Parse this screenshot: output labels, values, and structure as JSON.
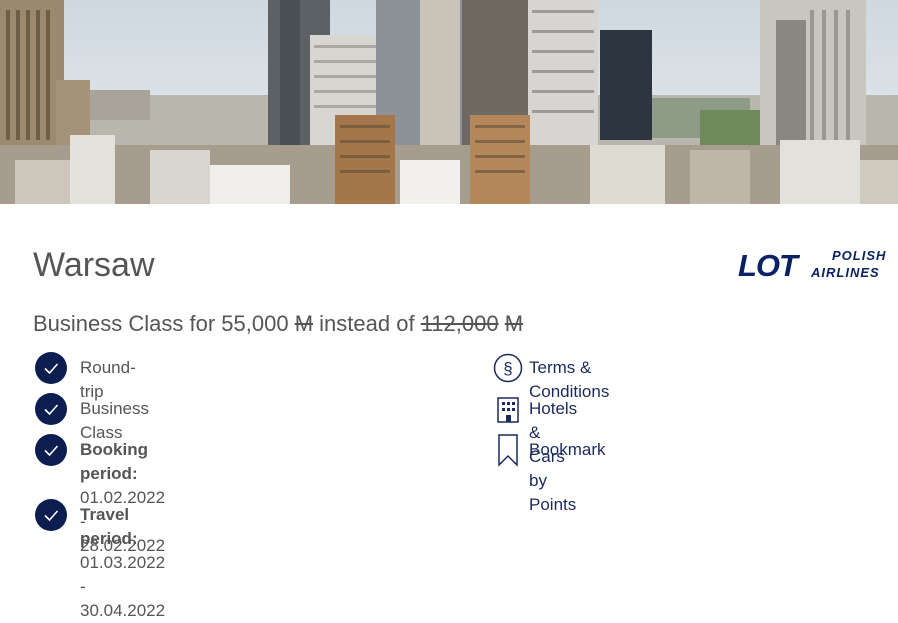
{
  "header": {
    "image_alt": "Warsaw skyline"
  },
  "destination": {
    "title": "Warsaw"
  },
  "brand": {
    "logo_main": "LOT",
    "logo_line1": "POLISH",
    "logo_line2": "AIRLINES"
  },
  "offer": {
    "prefix": "Business Class for 55,000",
    "currency": "M",
    "middle": "instead of",
    "old_price": "112,000",
    "old_currency": "M"
  },
  "features": [
    {
      "label": "Round-trip"
    },
    {
      "label": "Business Class"
    },
    {
      "heading": "Booking period:",
      "value": "01.02.2022 - 28.02.2022"
    },
    {
      "heading": "Travel period:",
      "value": "01.03.2022 - 30.04.2022"
    }
  ],
  "links": [
    {
      "label": "Terms & Conditions",
      "icon": "section-icon"
    },
    {
      "label": "Hotels & Cars by Points",
      "icon": "building-icon"
    },
    {
      "label": "Bookmark",
      "icon": "bookmark-icon"
    }
  ],
  "colors": {
    "brand": "#0a2164",
    "check_bg": "#0c1e4f",
    "link": "#1b2a5e"
  }
}
